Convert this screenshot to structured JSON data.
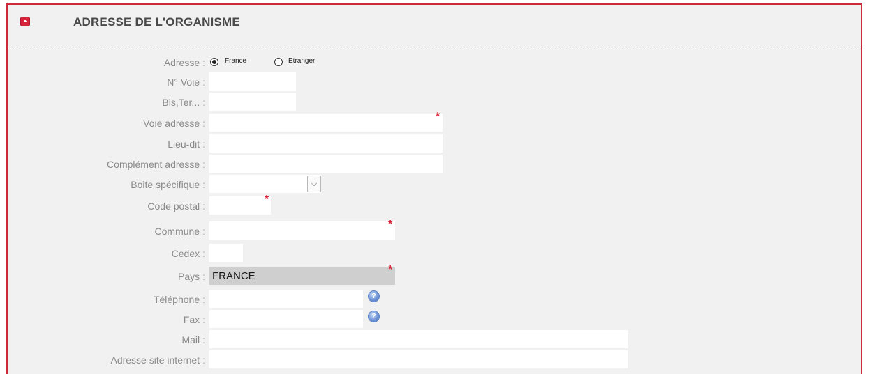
{
  "section": {
    "title": "ADRESSE DE L'ORGANISME"
  },
  "form": {
    "colon": ":",
    "required_mark": "*",
    "help_glyph": "?",
    "adresse": {
      "label": "Adresse",
      "options": [
        {
          "label": "France",
          "checked": true
        },
        {
          "label": "Etranger",
          "checked": false
        }
      ]
    },
    "no_voie": {
      "label": "N° Voie",
      "value": ""
    },
    "bis_ter": {
      "label": "Bis,Ter...",
      "value": ""
    },
    "voie_adresse": {
      "label": "Voie adresse",
      "value": "",
      "required": true
    },
    "lieu_dit": {
      "label": "Lieu-dit",
      "value": ""
    },
    "complement": {
      "label": "Complément adresse",
      "value": ""
    },
    "boite": {
      "label": "Boite spécifique",
      "value": "",
      "arrow": "⌵"
    },
    "code_postal": {
      "label": "Code postal",
      "value": "",
      "required": true
    },
    "commune": {
      "label": "Commune",
      "value": "",
      "required": true
    },
    "cedex": {
      "label": "Cedex",
      "value": ""
    },
    "pays": {
      "label": "Pays",
      "value": "FRANCE",
      "required": true
    },
    "telephone": {
      "label": "Téléphone",
      "value": ""
    },
    "fax": {
      "label": "Fax",
      "value": ""
    },
    "mail": {
      "label": "Mail",
      "value": ""
    },
    "site": {
      "label": "Adresse site internet",
      "value": ""
    }
  },
  "colors": {
    "accent": "#d8243a",
    "panel_bg": "#f1f1f1",
    "label": "#8a8a8a",
    "readonly_bg": "#cfcfcf"
  },
  "icons": {
    "collapse": "collapse-up-icon",
    "help": "help-icon"
  }
}
